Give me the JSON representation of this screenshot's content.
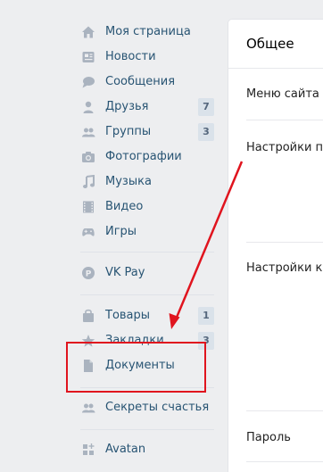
{
  "sidebar": {
    "items": [
      {
        "label": "Моя страница",
        "icon": "home-icon",
        "count": ""
      },
      {
        "label": "Новости",
        "icon": "news-icon",
        "count": ""
      },
      {
        "label": "Сообщения",
        "icon": "messages-icon",
        "count": ""
      },
      {
        "label": "Друзья",
        "icon": "friends-icon",
        "count": "7"
      },
      {
        "label": "Группы",
        "icon": "groups-icon",
        "count": "3"
      },
      {
        "label": "Фотографии",
        "icon": "camera-icon",
        "count": ""
      },
      {
        "label": "Музыка",
        "icon": "music-icon",
        "count": ""
      },
      {
        "label": "Видео",
        "icon": "video-icon",
        "count": ""
      },
      {
        "label": "Игры",
        "icon": "gamepad-icon",
        "count": ""
      },
      {
        "label": "VK Pay",
        "icon": "vkpay-icon",
        "count": ""
      },
      {
        "label": "Товары",
        "icon": "bag-icon",
        "count": "1"
      },
      {
        "label": "Закладки",
        "icon": "star-icon",
        "count": "3"
      },
      {
        "label": "Документы",
        "icon": "document-icon",
        "count": ""
      },
      {
        "label": "Секреты счастья",
        "icon": "friends-icon",
        "count": ""
      },
      {
        "label": "Avatan",
        "icon": "apps-icon",
        "count": ""
      }
    ]
  },
  "settings": {
    "title": "Общее",
    "rows": [
      "Меню сайта",
      "Настройки про",
      "Настройки ко",
      "Пароль"
    ]
  },
  "colors": {
    "background": "#edeef0",
    "link": "#285473",
    "icon": "#aab3bf",
    "annotation": "#e0141e",
    "badge": "#dae2ea"
  }
}
